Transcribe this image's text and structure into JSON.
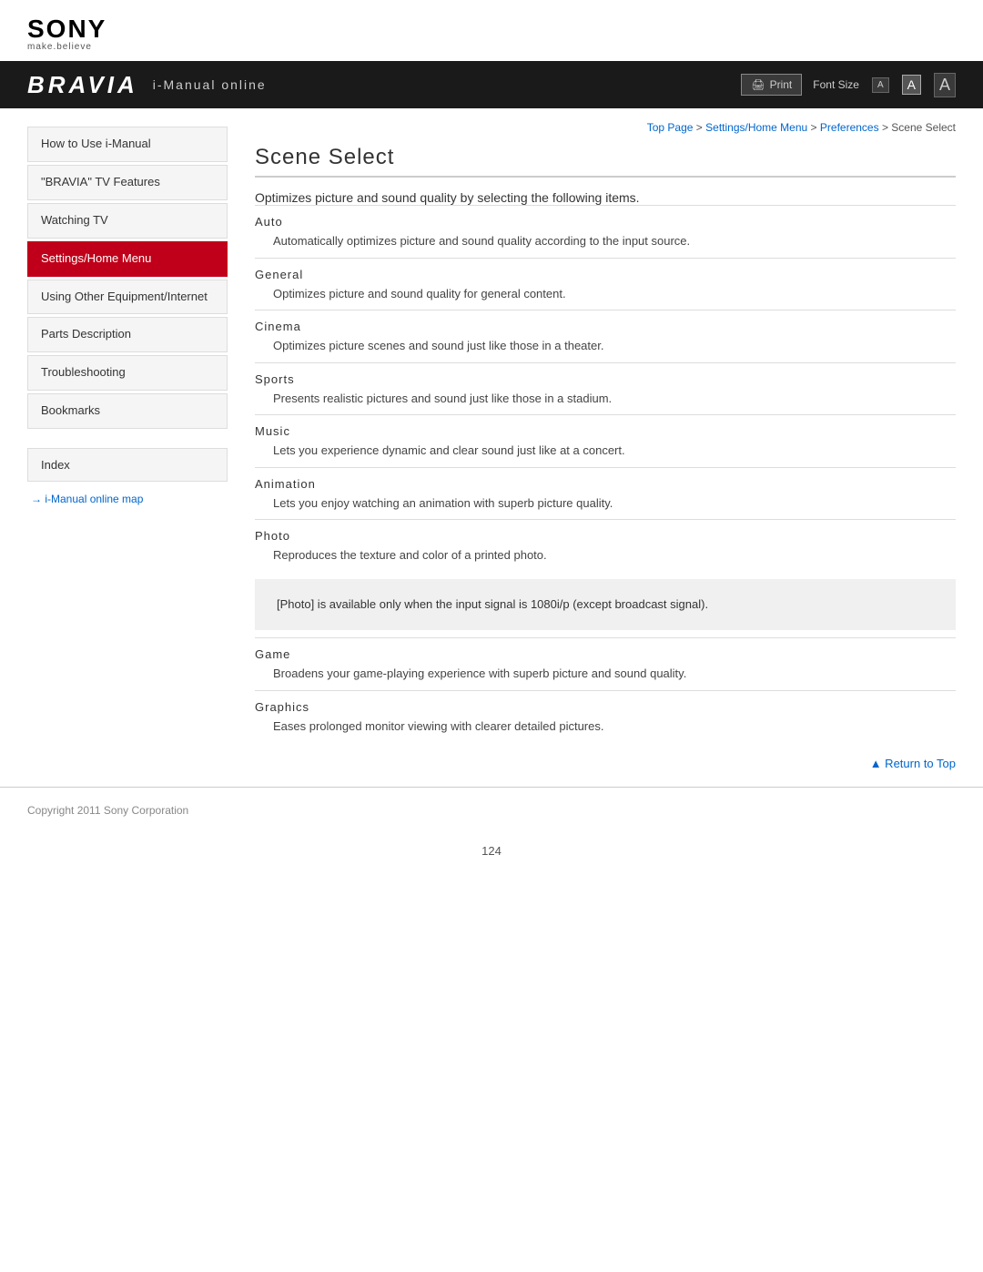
{
  "header": {
    "sony_text": "SONY",
    "sony_tagline": "make.believe",
    "bravia_logo": "BRAVIA",
    "bravia_subtitle": "i-Manual online",
    "print_label": "Print",
    "font_size_label": "Font Size",
    "font_small": "A",
    "font_medium": "A",
    "font_large": "A"
  },
  "breadcrumb": {
    "top_page": "Top Page",
    "settings": "Settings/Home Menu",
    "preferences": "Preferences",
    "current": "Scene Select",
    "separator": " > "
  },
  "sidebar": {
    "items": [
      {
        "id": "how-to-use",
        "label": "How to Use i-Manual"
      },
      {
        "id": "bravia-features",
        "label": "\"BRAVIA\" TV Features"
      },
      {
        "id": "watching-tv",
        "label": "Watching TV"
      },
      {
        "id": "settings-home",
        "label": "Settings/Home Menu",
        "active": true
      },
      {
        "id": "using-other",
        "label": "Using Other Equipment/Internet"
      },
      {
        "id": "parts-description",
        "label": "Parts Description"
      },
      {
        "id": "troubleshooting",
        "label": "Troubleshooting"
      },
      {
        "id": "bookmarks",
        "label": "Bookmarks"
      }
    ],
    "index_label": "Index",
    "map_link": "i-Manual online map"
  },
  "content": {
    "page_title": "Scene Select",
    "intro": "Optimizes picture and sound quality by selecting the following items.",
    "scenes": [
      {
        "title": "Auto",
        "desc": "Automatically optimizes picture and sound quality according to the input source."
      },
      {
        "title": "General",
        "desc": "Optimizes picture and sound quality for general content."
      },
      {
        "title": "Cinema",
        "desc": "Optimizes picture scenes and sound just like those in a theater."
      },
      {
        "title": "Sports",
        "desc": "Presents realistic pictures and sound just like those in a stadium."
      },
      {
        "title": "Music",
        "desc": "Lets you experience dynamic and clear sound just like at a concert."
      },
      {
        "title": "Animation",
        "desc": "Lets you enjoy watching an animation with superb picture quality."
      },
      {
        "title": "Photo",
        "desc": "Reproduces the texture and color of a printed photo."
      }
    ],
    "note": "[Photo] is available only when the input signal is 1080i/p (except broadcast signal).",
    "scenes_after_note": [
      {
        "title": "Game",
        "desc": "Broadens your game-playing experience with superb picture and sound quality."
      },
      {
        "title": "Graphics",
        "desc": "Eases prolonged monitor viewing with clearer detailed pictures."
      }
    ],
    "return_top": "▲ Return to Top"
  },
  "footer": {
    "copyright": "Copyright 2011 Sony Corporation"
  },
  "page_number": "124"
}
